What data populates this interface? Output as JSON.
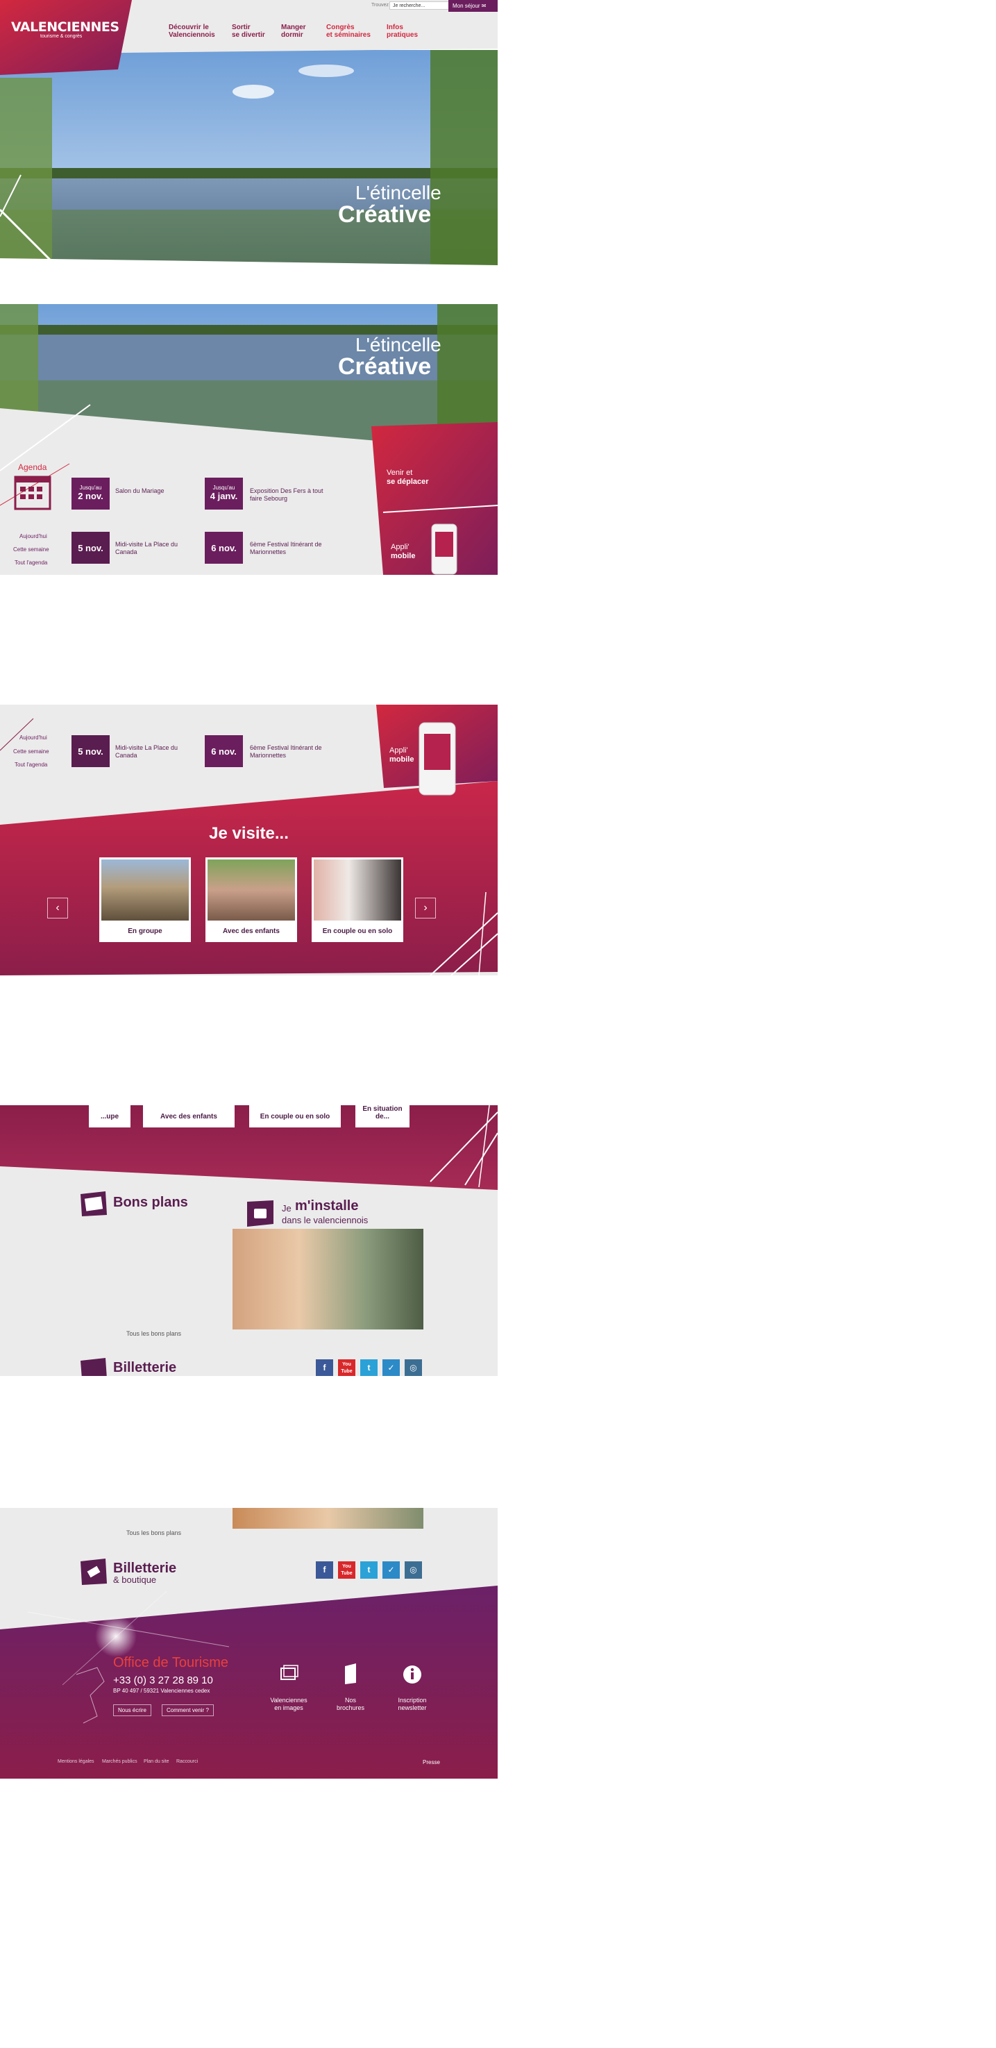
{
  "topbar": {
    "search_label": "Trouvez :",
    "search_placeholder": "Je recherche...",
    "my_stay": "Mon séjour"
  },
  "logo": {
    "name": "VALENCIENNES",
    "tagline": "tourisme & congrès"
  },
  "nav": [
    {
      "line1": "Découvrir le",
      "line2": "Valenciennois"
    },
    {
      "line1": "Sortir",
      "line2": "se divertir"
    },
    {
      "line1": "Manger",
      "line2": "dormir"
    },
    {
      "line1": "Congrès",
      "line2": "et séminaires"
    },
    {
      "line1": "Infos",
      "line2": "pratiques"
    }
  ],
  "hero": {
    "line1": "L'étincelle",
    "line2": "Créative"
  },
  "agenda": {
    "title": "Agenda",
    "links": [
      "Aujourd'hui",
      "Cette semaine",
      "Tout l'agenda"
    ],
    "events": [
      {
        "prefix": "Jusqu'au",
        "date": "2 nov.",
        "title": "Salon du Mariage"
      },
      {
        "prefix": "Jusqu'au",
        "date": "4 janv.",
        "title": "Exposition Des Fers à tout faire Sebourg"
      },
      {
        "prefix": "",
        "date": "5 nov.",
        "title": "Midi-visite La Place du Canada"
      },
      {
        "prefix": "",
        "date": "6 nov.",
        "title": "6ème Festival Itinérant de Marionnettes"
      }
    ]
  },
  "side": {
    "venir_1": "Venir et",
    "venir_2": "se déplacer",
    "appli_1": "Appli'",
    "appli_2": "mobile"
  },
  "visite": {
    "title": "Je visite...",
    "cards": [
      "En groupe",
      "Avec des enfants",
      "En couple ou en solo"
    ],
    "cards_scrolled": [
      "...upe",
      "Avec des enfants",
      "En couple ou en solo",
      "En situation de..."
    ]
  },
  "bons_plans": {
    "title": "Bons plans",
    "all_link": "Tous les bons plans",
    "badge": "BONS PLANS"
  },
  "installe": {
    "je": "Je",
    "title": "m'installe",
    "sub": "dans le valenciennois"
  },
  "billetterie": {
    "title": "Billetterie",
    "sub": "& boutique"
  },
  "social": [
    "f",
    "You Tube",
    "t",
    "✓",
    "◎"
  ],
  "footer": {
    "office": "Office de Tourisme",
    "phone": "+33 (0) 3 27 28 89 10",
    "address": "BP 40 497 / 59321 Valenciennes cedex",
    "btn_write": "Nous écrire",
    "btn_come": "Comment venir ?",
    "icons": [
      {
        "l1": "Valenciennes",
        "l2": "en images"
      },
      {
        "l1": "Nos",
        "l2": "brochures"
      },
      {
        "l1": "Inscription",
        "l2": "newsletter"
      }
    ],
    "legal": [
      "Mentions légales",
      "Marchés publics",
      "Plan du site",
      "Raccourci"
    ],
    "presse": "Presse"
  }
}
